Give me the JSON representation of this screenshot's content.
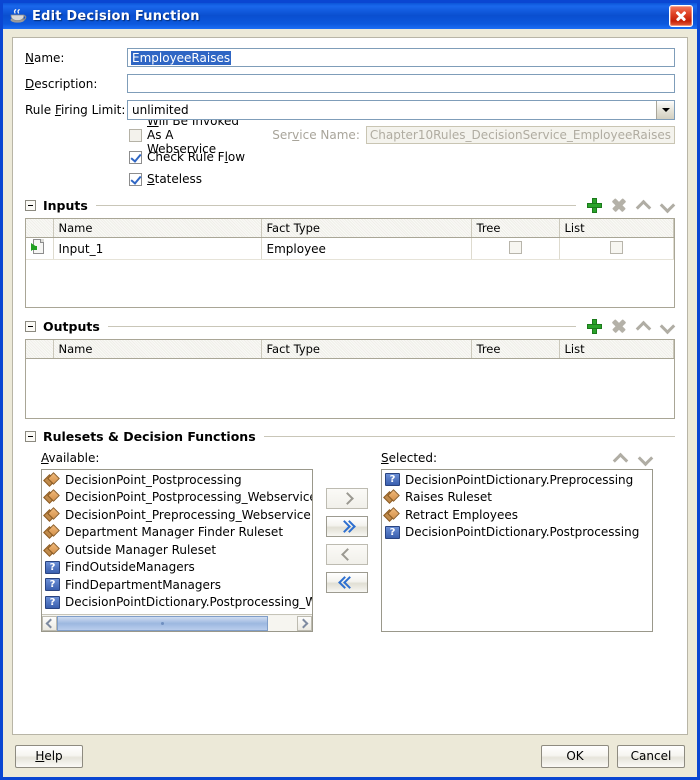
{
  "window": {
    "title": "Edit Decision Function",
    "title_icon": "java-coffee-cup-icon",
    "close_label": "×"
  },
  "form": {
    "name": {
      "label_pre": "N",
      "label_accel": "a",
      "label_post": "me:",
      "label": "Name:",
      "value": "EmployeeRaises",
      "selected": true
    },
    "description": {
      "label": "Description:",
      "value": "",
      "placeholder": ""
    },
    "rule_firing_limit": {
      "label": "Rule Firing Limit:",
      "value": "unlimited"
    },
    "checkboxes": [
      {
        "name": "webservice",
        "label": "Will Be Invoked As A Webservice",
        "checked": false,
        "disabled": false
      },
      {
        "name": "check-rule-flow",
        "label": "Check Rule Flow",
        "checked": true,
        "disabled": false
      },
      {
        "name": "stateless",
        "label": "Stateless",
        "checked": true,
        "disabled": false
      }
    ],
    "service_name": {
      "label": "Service Name:",
      "value": "Chapter10Rules_DecisionService_EmployeeRaises",
      "disabled": true
    }
  },
  "inputs_section": {
    "title": "Inputs",
    "expanded": true,
    "tools": [
      "add-icon",
      "delete-icon",
      "move-up-icon",
      "move-down-icon"
    ],
    "columns": [
      "",
      "Name",
      "Fact Type",
      "Tree",
      "List"
    ],
    "rows": [
      {
        "icon": "input-document-icon",
        "name": "Input_1",
        "fact_type": "Employee",
        "tree": false,
        "list": false
      }
    ]
  },
  "outputs_section": {
    "title": "Outputs",
    "expanded": true,
    "tools": [
      "add-icon",
      "delete-icon",
      "move-up-icon",
      "move-down-icon"
    ],
    "columns": [
      "",
      "Name",
      "Fact Type",
      "Tree",
      "List"
    ],
    "rows": []
  },
  "rulesets_section": {
    "title": "Rulesets & Decision Functions",
    "expanded": true,
    "available": {
      "label": "Available:",
      "items": [
        {
          "label": "DecisionPoint_Postprocessing",
          "icon": "ruleset-icon"
        },
        {
          "label": "DecisionPoint_Postprocessing_Webservice",
          "icon": "ruleset-icon"
        },
        {
          "label": "DecisionPoint_Preprocessing_Webservice",
          "icon": "ruleset-icon"
        },
        {
          "label": "Department Manager Finder Ruleset",
          "icon": "ruleset-icon"
        },
        {
          "label": "Outside Manager Ruleset",
          "icon": "ruleset-icon"
        },
        {
          "label": "FindOutsideManagers",
          "icon": "decision-function-icon"
        },
        {
          "label": "FindDepartmentManagers",
          "icon": "decision-function-icon"
        },
        {
          "label": "DecisionPointDictionary.Postprocessing_Webservice",
          "icon": "decision-function-icon"
        }
      ]
    },
    "selected": {
      "label": "Selected:",
      "items": [
        {
          "label": "DecisionPointDictionary.Preprocessing",
          "icon": "decision-function-icon"
        },
        {
          "label": "Raises Ruleset",
          "icon": "ruleset-icon"
        },
        {
          "label": "Retract Employees",
          "icon": "ruleset-icon"
        },
        {
          "label": "DecisionPointDictionary.Postprocessing",
          "icon": "decision-function-icon"
        }
      ],
      "tools": [
        "move-up-icon",
        "move-down-icon"
      ]
    },
    "transfer_buttons": [
      {
        "name": "move-right-button",
        "glyph": "›",
        "enabled": false
      },
      {
        "name": "move-all-right-button",
        "glyph": "»",
        "enabled": true
      },
      {
        "name": "move-left-button",
        "glyph": "‹",
        "enabled": false
      },
      {
        "name": "move-all-left-button",
        "glyph": "«",
        "enabled": true
      }
    ]
  },
  "footer": {
    "help": "Help",
    "ok": "OK",
    "cancel": "Cancel"
  }
}
